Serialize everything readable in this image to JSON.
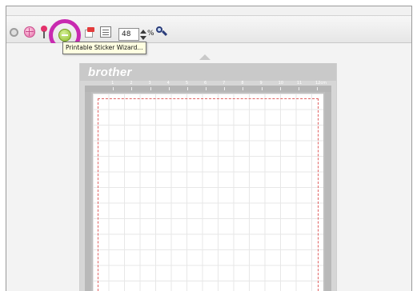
{
  "toolbar": {
    "zoom_value": "48",
    "zoom_unit": "%",
    "buttons": [
      {
        "name": "grey-circle-icon"
      },
      {
        "name": "globe-icon"
      },
      {
        "name": "pin-icon"
      },
      {
        "name": "printable-sticker-wizard-icon",
        "highlighted": true
      },
      {
        "name": "red-tab-sheet-icon"
      },
      {
        "name": "list-icon"
      },
      {
        "name": "magnifier-icon"
      }
    ],
    "highlight_color": "#c82ab0"
  },
  "tooltip": {
    "text": "Printable Sticker Wizard..."
  },
  "mat": {
    "brand": "brother",
    "unit": "cm",
    "ruler_numbers": [
      "1",
      "2",
      "3",
      "4",
      "5",
      "6",
      "7",
      "8",
      "9",
      "10",
      "11",
      "12"
    ],
    "cut_line_color": "#e06060"
  }
}
